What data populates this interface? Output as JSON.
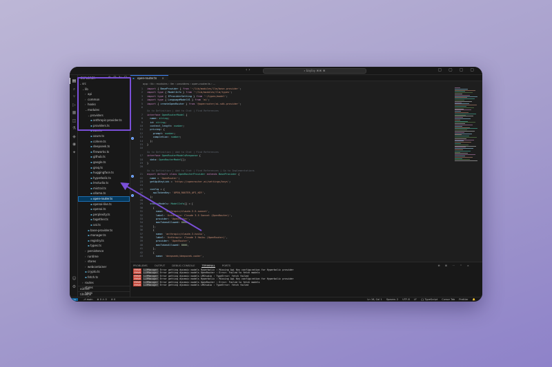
{
  "titlebar": {
    "search": "⌕ baylay ⌘⌘ ⌘",
    "nav": "‹  ›",
    "actions": "▢ ▢ ▢ ▢"
  },
  "activity": {
    "icons": [
      "files-icon",
      "search-icon",
      "source-control-icon",
      "run-debug-icon",
      "extensions-icon",
      "remote-explorer-icon",
      "testing-icon",
      "docker-icon",
      "github-icon",
      "copilot-icon",
      "account-icon",
      "settings-icon"
    ]
  },
  "sidebar": {
    "header": "explorer",
    "header_icons": "⊕ ⊞ ↻ ⊟",
    "items": [
      {
        "label": "src",
        "depth": 0,
        "kind": "folder",
        "open": true
      },
      {
        "label": "lib",
        "depth": 1,
        "kind": "folder",
        "open": true
      },
      {
        "label": "api",
        "depth": 2,
        "kind": "folder",
        "open": false
      },
      {
        "label": "common",
        "depth": 2,
        "kind": "folder",
        "open": false
      },
      {
        "label": "hooks",
        "depth": 2,
        "kind": "folder",
        "open": false
      },
      {
        "label": "modules",
        "depth": 2,
        "kind": "folder",
        "open": true
      },
      {
        "label": "providers",
        "depth": 3,
        "kind": "folder",
        "open": true
      },
      {
        "label": "anthropic-provider.ts",
        "depth": 4,
        "kind": "file"
      },
      {
        "label": "providers.ts",
        "depth": 4,
        "kind": "file"
      },
      {
        "label": "aws.ts",
        "depth": 4,
        "kind": "file"
      },
      {
        "label": "azure.ts",
        "depth": 4,
        "kind": "file"
      },
      {
        "label": "cohere.ts",
        "depth": 4,
        "kind": "file"
      },
      {
        "label": "deepseek.ts",
        "depth": 4,
        "kind": "file"
      },
      {
        "label": "fireworks.ts",
        "depth": 4,
        "kind": "file"
      },
      {
        "label": "github.ts",
        "depth": 4,
        "kind": "file"
      },
      {
        "label": "google.ts",
        "depth": 4,
        "kind": "file"
      },
      {
        "label": "groq.ts",
        "depth": 4,
        "kind": "file"
      },
      {
        "label": "huggingface.ts",
        "depth": 4,
        "kind": "file"
      },
      {
        "label": "hyperbolic.ts",
        "depth": 4,
        "kind": "file"
      },
      {
        "label": "lmstudio.ts",
        "depth": 4,
        "kind": "file"
      },
      {
        "label": "mistral.ts",
        "depth": 4,
        "kind": "file"
      },
      {
        "label": "ollama.ts",
        "depth": 4,
        "kind": "file"
      },
      {
        "label": "open-router.ts",
        "depth": 4,
        "kind": "file",
        "selected": true
      },
      {
        "label": "openai-like.ts",
        "depth": 4,
        "kind": "file"
      },
      {
        "label": "openai.ts",
        "depth": 4,
        "kind": "file"
      },
      {
        "label": "perplexity.ts",
        "depth": 4,
        "kind": "file"
      },
      {
        "label": "together.ts",
        "depth": 4,
        "kind": "file"
      },
      {
        "label": "xai.ts",
        "depth": 4,
        "kind": "file"
      },
      {
        "label": "base-provider.ts",
        "depth": 3,
        "kind": "file"
      },
      {
        "label": "manager.ts",
        "depth": 3,
        "kind": "file"
      },
      {
        "label": "registry.ts",
        "depth": 3,
        "kind": "file"
      },
      {
        "label": "types.ts",
        "depth": 3,
        "kind": "file"
      },
      {
        "label": "persistence",
        "depth": 2,
        "kind": "folder",
        "open": false
      },
      {
        "label": "runtime",
        "depth": 2,
        "kind": "folder",
        "open": false
      },
      {
        "label": "stores",
        "depth": 2,
        "kind": "folder",
        "open": false
      },
      {
        "label": "webcontainer",
        "depth": 2,
        "kind": "folder",
        "open": false
      },
      {
        "label": "crypto.ts",
        "depth": 2,
        "kind": "file"
      },
      {
        "label": "fetch.ts",
        "depth": 2,
        "kind": "file"
      },
      {
        "label": "routes",
        "depth": 1,
        "kind": "folder",
        "open": false
      },
      {
        "label": "styles",
        "depth": 1,
        "kind": "folder",
        "open": false
      },
      {
        "label": "types",
        "depth": 1,
        "kind": "folder",
        "open": false
      },
      {
        "label": "utils",
        "depth": 1,
        "kind": "folder",
        "open": false
      },
      {
        "label": "entry.client.tsx",
        "depth": 1,
        "kind": "file"
      },
      {
        "label": "entry.server.tsx",
        "depth": 1,
        "kind": "file"
      }
    ],
    "bottom": [
      "outline",
      "timeline"
    ]
  },
  "editor": {
    "tab_label": "open-router.ts",
    "tab_close": "×",
    "breadcrumb": "app › lib › modules › llm › providers › open-router.ts › ...",
    "lines": [
      {
        "n": "1",
        "html": "<span class='k'>import</span> { <span class='v'>BaseProvider</span> } <span class='k'>from</span> <span class='s'>'~/lib/modules/llm/base-provider'</span>;"
      },
      {
        "n": "2",
        "html": "<span class='k'>import</span> <span class='k'>type</span> { <span class='v'>ModelInfo</span> } <span class='k'>from</span> <span class='s'>'~/lib/modules/llm/types'</span>;"
      },
      {
        "n": "3",
        "html": "<span class='k'>import</span> <span class='k'>type</span> { <span class='v'>IProviderSetting</span> } <span class='k'>from</span> <span class='s'>'~/types/model'</span>;"
      },
      {
        "n": "4",
        "html": "<span class='k'>import</span> <span class='k'>type</span> { <span class='v'>LanguageModelV1</span> } <span class='k'>from</span> <span class='s'>'ai'</span>;"
      },
      {
        "n": "5",
        "html": "<span class='k'>import</span> { <span class='v'>createOpenRouter</span> } <span class='k'>from</span> <span class='s'>'@openrouter/ai-sdk-provider'</span>;"
      },
      {
        "n": "6",
        "html": ""
      },
      {
        "n": "",
        "html": "<span class='dim'>Go to Definition | Add to Chat | Find References</span>"
      },
      {
        "n": "7",
        "html": "<span class='k'>interface</span> <span class='t'>OpenRouterModel</span> {"
      },
      {
        "n": "8",
        "html": "  <span class='v'>name</span>: <span class='t'>string</span>;"
      },
      {
        "n": "9",
        "html": "  <span class='v'>id</span>: <span class='t'>string</span>;"
      },
      {
        "n": "10",
        "html": "  <span class='v'>context_length</span>: <span class='t'>number</span>;"
      },
      {
        "n": "11",
        "html": "  <span class='v'>pricing</span>: {"
      },
      {
        "n": "12",
        "html": "    <span class='v'>prompt</span>: <span class='t'>number</span>;"
      },
      {
        "n": "13",
        "html": "    <span class='v'>completion</span>: <span class='t'>number</span>;"
      },
      {
        "n": "14",
        "html": "  };"
      },
      {
        "n": "15",
        "html": "}"
      },
      {
        "n": "16",
        "html": ""
      },
      {
        "n": "",
        "html": "<span class='dim'>Go to Definition | Add to Chat | Find References</span>"
      },
      {
        "n": "17",
        "html": "<span class='k'>interface</span> <span class='t'>OpenRouterModelsResponse</span> {"
      },
      {
        "n": "18",
        "html": "  <span class='v'>data</span>: <span class='t'>OpenRouterModel</span>[];"
      },
      {
        "n": "19",
        "html": "}"
      },
      {
        "n": "20",
        "html": ""
      },
      {
        "n": "",
        "html": "<span class='dim'>Go to Definition | Add to Chat | Find References | Go to Implementations</span>"
      },
      {
        "n": "21",
        "html": "<span class='k'>export default class</span> <span class='t'>OpenRouterProvider</span> <span class='k'>extends</span> <span class='t'>BaseProvider</span> {"
      },
      {
        "n": "22",
        "html": "  <span class='v'>name</span> = <span class='s'>'OpenRouter'</span>;"
      },
      {
        "n": "23",
        "html": "  <span class='v'>getApiKeyLink</span> = <span class='s'>'https://openrouter.ai/settings/keys'</span>;"
      },
      {
        "n": "24",
        "html": ""
      },
      {
        "n": "25",
        "html": "  <span class='v'>config</span> = {"
      },
      {
        "n": "26",
        "html": "    <span class='v'>apiTokenKey</span>: <span class='s'>'OPEN_ROUTER_API_KEY'</span>,"
      },
      {
        "n": "27",
        "html": "  };"
      },
      {
        "n": "28",
        "html": ""
      },
      {
        "n": "29",
        "html": "  <span class='v'>staticModels</span>: <span class='t'>ModelInfo</span>[] = ["
      },
      {
        "n": "30",
        "html": "    {"
      },
      {
        "n": "31",
        "html": "      <span class='v'>name</span>: <span class='s'>'anthropic/claude-3.5-sonnet'</span>,"
      },
      {
        "n": "32",
        "html": "      <span class='v'>label</span>: <span class='s'>'Anthropic: Claude 3.5 Sonnet (OpenRouter)'</span>,"
      },
      {
        "n": "33",
        "html": "      <span class='v'>provider</span>: <span class='s'>'OpenRouter'</span>,"
      },
      {
        "n": "34",
        "html": "      <span class='v'>maxTokenAllowed</span>: <span class='n'>8000</span>,"
      },
      {
        "n": "35",
        "html": "    },"
      },
      {
        "n": "36",
        "html": "    {"
      },
      {
        "n": "37",
        "html": "      <span class='v'>name</span>: <span class='s'>'anthropic/claude-3-haiku'</span>,"
      },
      {
        "n": "38",
        "html": "      <span class='v'>label</span>: <span class='s'>'Anthropic: Claude 3 Haiku (OpenRouter)'</span>,"
      },
      {
        "n": "39",
        "html": "      <span class='v'>provider</span>: <span class='s'>'OpenRouter'</span>,"
      },
      {
        "n": "40",
        "html": "      <span class='v'>maxTokenAllowed</span>: <span class='n'>8000</span>,"
      },
      {
        "n": "41",
        "html": "    },"
      },
      {
        "n": "42",
        "html": "    {"
      },
      {
        "n": "43",
        "html": "      <span class='v'>name</span>: <span class='s'>'deepseek/deepseek-coder'</span>,"
      }
    ]
  },
  "panel": {
    "tabs": [
      {
        "label": "PROBLEMS",
        "badge": ""
      },
      {
        "label": "OUTPUT",
        "badge": ""
      },
      {
        "label": "DEBUG CONSOLE",
        "badge": ""
      },
      {
        "label": "TERMINAL",
        "badge": "",
        "active": true
      },
      {
        "label": "PORTS",
        "badge": ""
      }
    ],
    "actions": "⊕ ⊞ ⋯ ^ ×",
    "rows": [
      {
        "tag": "ERROR",
        "src": "LLMManager",
        "msg": "Error getting dynamic models Hyperbolic : Missing Api Key configuration for Hyperbolic provider"
      },
      {
        "tag": "ERROR",
        "src": "LLMManager",
        "msg": "Error getting dynamic models OpenRouter : Error: Failed to fetch models"
      },
      {
        "tag": "ERROR",
        "src": "LLMManager",
        "msg": "Error getting dynamic models LMStudio : TypeError: fetch failed"
      },
      {
        "tag": "ERROR",
        "src": "LLMManager",
        "msg": "Error getting dynamic models Hyperbolic : Missing Api Key configuration for Hyperbolic provider"
      },
      {
        "tag": "ERROR",
        "src": "LLMManager",
        "msg": "Error getting dynamic models OpenRouter : Error: Failed to fetch models"
      },
      {
        "tag": "ERROR",
        "src": "LLMManager",
        "msg": "Error getting dynamic models LMStudio : TypeError: fetch failed"
      }
    ]
  },
  "statusbar": {
    "remote": "⌥",
    "left": [
      "⎇ main",
      "⊗ 0 ⚠ 0",
      "⊘ 0"
    ],
    "right": [
      "Ln 16, Col 1",
      "Spaces: 2",
      "UTF-8",
      "LF",
      "{} TypeScript",
      "Cursor Tab",
      "Prettier",
      "🔔"
    ]
  },
  "colors": {
    "accent": "#3b82f6",
    "highlight": "#7a4fd8",
    "error": "#c0392b"
  }
}
